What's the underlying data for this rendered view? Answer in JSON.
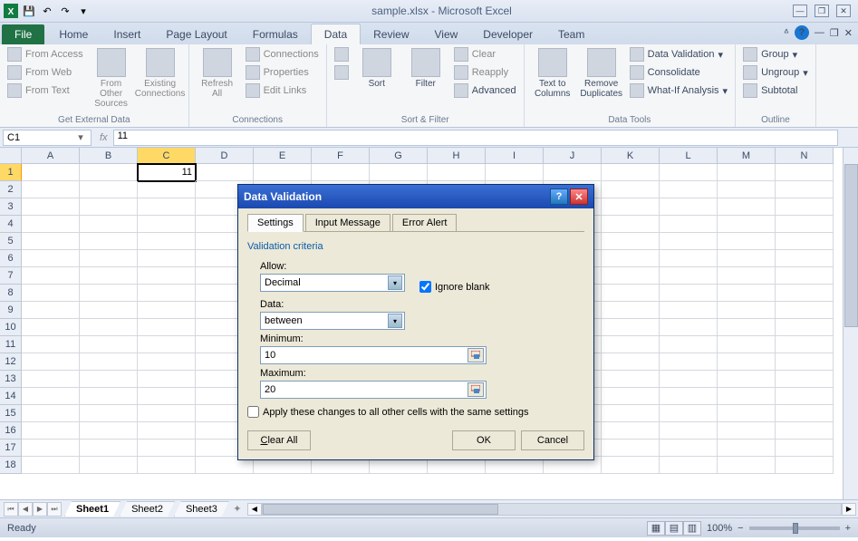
{
  "title": "sample.xlsx - Microsoft Excel",
  "qat": {
    "save": "💾",
    "undo": "↶",
    "redo": "↷"
  },
  "ribbonTabs": [
    "Home",
    "Insert",
    "Page Layout",
    "Formulas",
    "Data",
    "Review",
    "View",
    "Developer",
    "Team"
  ],
  "activeRibbonTab": "Data",
  "fileTab": "File",
  "ribbon": {
    "getExternal": {
      "label": "Get External Data",
      "fromAccess": "From Access",
      "fromWeb": "From Web",
      "fromText": "From Text",
      "fromOther": "From Other\nSources",
      "existing": "Existing\nConnections"
    },
    "connections": {
      "label": "Connections",
      "refreshAll": "Refresh\nAll",
      "conn": "Connections",
      "prop": "Properties",
      "links": "Edit Links"
    },
    "sortFilter": {
      "label": "Sort & Filter",
      "az": "A→Z",
      "za": "Z→A",
      "sort": "Sort",
      "filter": "Filter",
      "clear": "Clear",
      "reapply": "Reapply",
      "advanced": "Advanced"
    },
    "dataTools": {
      "label": "Data Tools",
      "textToCols": "Text to\nColumns",
      "removeDup": "Remove\nDuplicates",
      "validation": "Data Validation",
      "consolidate": "Consolidate",
      "whatIf": "What-If Analysis"
    },
    "outline": {
      "label": "Outline",
      "group": "Group",
      "ungroup": "Ungroup",
      "subtotal": "Subtotal"
    }
  },
  "nameBox": "C1",
  "formula": "11",
  "columns": [
    "A",
    "B",
    "C",
    "D",
    "E",
    "F",
    "G",
    "H",
    "I",
    "J",
    "K",
    "L",
    "M",
    "N"
  ],
  "activeCol": "C",
  "rowCount": 18,
  "activeRow": 1,
  "cellValue": "11",
  "sheets": [
    "Sheet1",
    "Sheet2",
    "Sheet3"
  ],
  "activeSheet": "Sheet1",
  "status": "Ready",
  "zoom": "100%",
  "dialog": {
    "title": "Data Validation",
    "tabs": [
      "Settings",
      "Input Message",
      "Error Alert"
    ],
    "activeTab": "Settings",
    "legend": "Validation criteria",
    "allowLabel": "Allow:",
    "allowValue": "Decimal",
    "ignoreBlank": "Ignore blank",
    "ignoreBlankChecked": true,
    "dataLabel": "Data:",
    "dataValue": "between",
    "minLabel": "Minimum:",
    "minValue": "10",
    "maxLabel": "Maximum:",
    "maxValue": "20",
    "applyAll": "Apply these changes to all other cells with the same settings",
    "applyAllChecked": false,
    "clearAll": "Clear All",
    "ok": "OK",
    "cancel": "Cancel"
  }
}
